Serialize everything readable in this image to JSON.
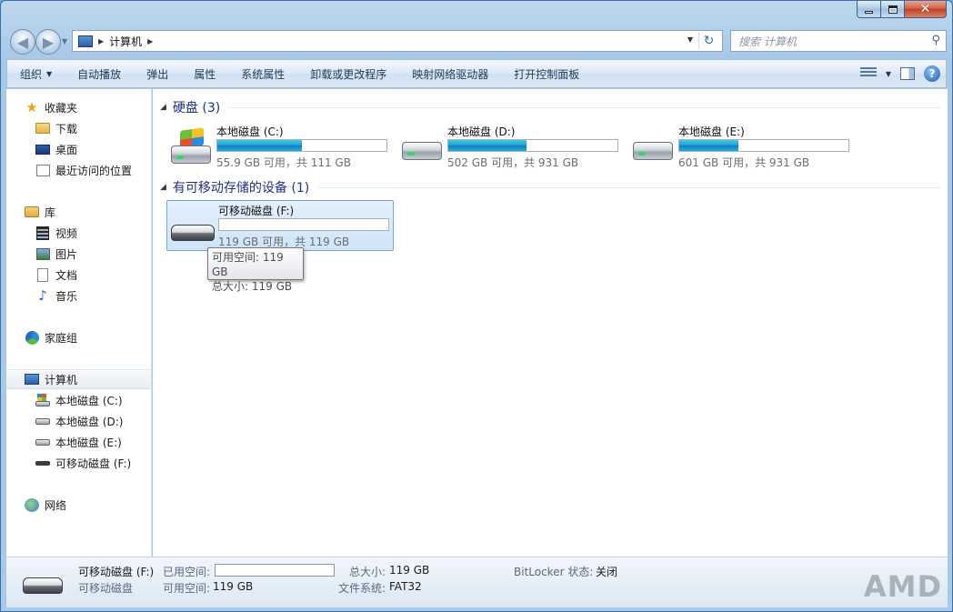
{
  "window": {
    "min_symbol": "",
    "max_symbol": "",
    "close_symbol": "✕"
  },
  "address": {
    "crumb": "计算机"
  },
  "search": {
    "placeholder": "搜索 计算机"
  },
  "toolbar": {
    "items": [
      "组织",
      "自动播放",
      "弹出",
      "属性",
      "系统属性",
      "卸载或更改程序",
      "映射网络驱动器",
      "打开控制面板"
    ]
  },
  "nav": {
    "favorites": "收藏夹",
    "downloads": "下载",
    "desktop": "桌面",
    "recent": "最近访问的位置",
    "libraries": "库",
    "videos": "视频",
    "pictures": "图片",
    "documents": "文档",
    "music": "音乐",
    "homegroup": "家庭组",
    "computer": "计算机",
    "drive_c": "本地磁盘 (C:)",
    "drive_d": "本地磁盘 (D:)",
    "drive_e": "本地磁盘 (E:)",
    "drive_f": "可移动磁盘 (F:)",
    "network": "网络"
  },
  "main": {
    "hard_disks_title": "硬盘 (3)",
    "removable_title": "有可移动存储的设备 (1)",
    "drives": [
      {
        "name": "本地磁盘 (C:)",
        "info": "55.9 GB 可用，共 111 GB",
        "used_fraction": 0.5
      },
      {
        "name": "本地磁盘 (D:)",
        "info": "502 GB 可用，共 931 GB",
        "used_fraction": 0.46
      },
      {
        "name": "本地磁盘 (E:)",
        "info": "601 GB 可用，共 931 GB",
        "used_fraction": 0.35
      }
    ],
    "removable": {
      "name": "可移动磁盘 (F:)",
      "info": "119 GB 可用，共 119 GB",
      "used_fraction": 0.0
    },
    "tooltip": {
      "line1": "可用空间: 119 GB",
      "line2": "总大小: 119 GB"
    }
  },
  "details": {
    "name": "可移动磁盘 (F:)",
    "type": "可移动磁盘",
    "used_label": "已用空间:",
    "free_label": "可用空间:",
    "free_value": "119 GB",
    "total_label": "总大小:",
    "total_value": "119 GB",
    "fs_label": "文件系统:",
    "fs_value": "FAT32",
    "bitlocker_label": "BitLocker 状态:",
    "bitlocker_value": "关闭"
  },
  "watermark": "AMD"
}
